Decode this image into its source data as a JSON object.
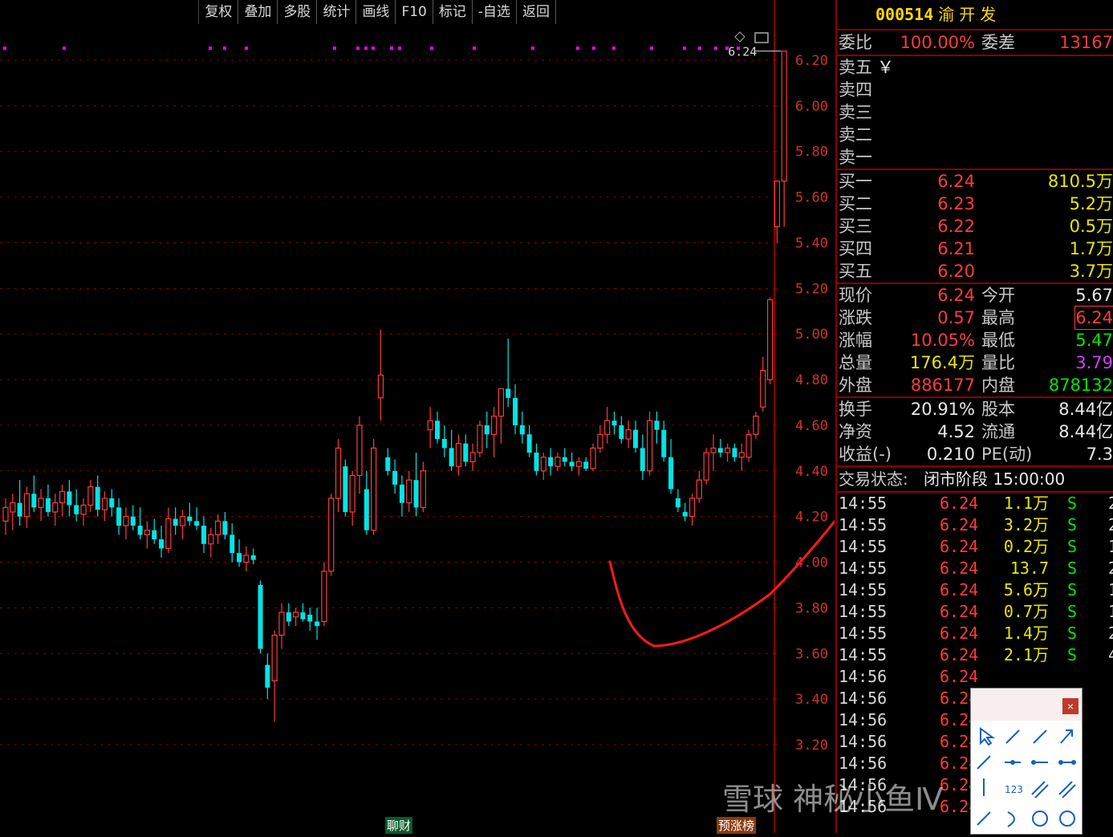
{
  "toolbar": {
    "items": [
      "复权",
      "叠加",
      "多股",
      "统计",
      "画线",
      "F10",
      "标记",
      "-自选",
      "返回"
    ]
  },
  "chart": {
    "y_ticks": [
      "6.20",
      "6.00",
      "5.80",
      "5.60",
      "5.40",
      "5.20",
      "5.00",
      "4.80",
      "4.60",
      "4.40",
      "4.20",
      "4.00",
      "3.80",
      "3.60",
      "3.40",
      "3.20"
    ],
    "high_label": "6.24",
    "badge_left": "聊财",
    "badge_right": "预涨榜",
    "colors": {
      "up": "#ff3b3b",
      "down": "#00e5e5",
      "grid": "#8b0000",
      "tick": "#d03030"
    }
  },
  "chart_data": {
    "type": "candlestick",
    "y_range": [
      3.1,
      6.3
    ],
    "candles": [
      {
        "o": 4.18,
        "h": 4.28,
        "l": 4.12,
        "c": 4.24
      },
      {
        "o": 4.22,
        "h": 4.3,
        "l": 4.14,
        "c": 4.26
      },
      {
        "o": 4.26,
        "h": 4.36,
        "l": 4.16,
        "c": 4.2
      },
      {
        "o": 4.2,
        "h": 4.33,
        "l": 4.15,
        "c": 4.3
      },
      {
        "o": 4.3,
        "h": 4.38,
        "l": 4.22,
        "c": 4.24
      },
      {
        "o": 4.24,
        "h": 4.32,
        "l": 4.18,
        "c": 4.28
      },
      {
        "o": 4.28,
        "h": 4.34,
        "l": 4.2,
        "c": 4.22
      },
      {
        "o": 4.22,
        "h": 4.3,
        "l": 4.16,
        "c": 4.26
      },
      {
        "o": 4.26,
        "h": 4.34,
        "l": 4.2,
        "c": 4.31
      },
      {
        "o": 4.31,
        "h": 4.36,
        "l": 4.2,
        "c": 4.25
      },
      {
        "o": 4.25,
        "h": 4.32,
        "l": 4.18,
        "c": 4.21
      },
      {
        "o": 4.21,
        "h": 4.28,
        "l": 4.16,
        "c": 4.25
      },
      {
        "o": 4.25,
        "h": 4.36,
        "l": 4.22,
        "c": 4.33
      },
      {
        "o": 4.33,
        "h": 4.38,
        "l": 4.2,
        "c": 4.23
      },
      {
        "o": 4.23,
        "h": 4.31,
        "l": 4.18,
        "c": 4.28
      },
      {
        "o": 4.28,
        "h": 4.32,
        "l": 4.2,
        "c": 4.24
      },
      {
        "o": 4.24,
        "h": 4.28,
        "l": 4.12,
        "c": 4.16
      },
      {
        "o": 4.16,
        "h": 4.24,
        "l": 4.1,
        "c": 4.2
      },
      {
        "o": 4.2,
        "h": 4.25,
        "l": 4.14,
        "c": 4.16
      },
      {
        "o": 4.16,
        "h": 4.24,
        "l": 4.1,
        "c": 4.12
      },
      {
        "o": 4.12,
        "h": 4.18,
        "l": 4.06,
        "c": 4.14
      },
      {
        "o": 4.14,
        "h": 4.19,
        "l": 4.08,
        "c": 4.1
      },
      {
        "o": 4.1,
        "h": 4.16,
        "l": 4.02,
        "c": 4.06
      },
      {
        "o": 4.06,
        "h": 4.24,
        "l": 4.04,
        "c": 4.19
      },
      {
        "o": 4.19,
        "h": 4.24,
        "l": 4.12,
        "c": 4.16
      },
      {
        "o": 4.16,
        "h": 4.23,
        "l": 4.1,
        "c": 4.2
      },
      {
        "o": 4.2,
        "h": 4.26,
        "l": 4.16,
        "c": 4.18
      },
      {
        "o": 4.18,
        "h": 4.24,
        "l": 4.14,
        "c": 4.16
      },
      {
        "o": 4.16,
        "h": 4.2,
        "l": 4.04,
        "c": 4.08
      },
      {
        "o": 4.08,
        "h": 4.15,
        "l": 4.02,
        "c": 4.12
      },
      {
        "o": 4.12,
        "h": 4.21,
        "l": 4.08,
        "c": 4.18
      },
      {
        "o": 4.18,
        "h": 4.22,
        "l": 4.1,
        "c": 4.12
      },
      {
        "o": 4.12,
        "h": 4.17,
        "l": 4.0,
        "c": 4.04
      },
      {
        "o": 4.04,
        "h": 4.1,
        "l": 3.98,
        "c": 4.0
      },
      {
        "o": 4.0,
        "h": 4.07,
        "l": 3.96,
        "c": 4.03
      },
      {
        "o": 4.03,
        "h": 4.06,
        "l": 3.99,
        "c": 4.01
      },
      {
        "o": 3.9,
        "h": 3.92,
        "l": 3.6,
        "c": 3.62
      },
      {
        "o": 3.55,
        "h": 3.6,
        "l": 3.4,
        "c": 3.45
      },
      {
        "o": 3.48,
        "h": 3.7,
        "l": 3.3,
        "c": 3.68
      },
      {
        "o": 3.68,
        "h": 3.82,
        "l": 3.62,
        "c": 3.78
      },
      {
        "o": 3.78,
        "h": 3.82,
        "l": 3.72,
        "c": 3.74
      },
      {
        "o": 3.76,
        "h": 3.8,
        "l": 3.72,
        "c": 3.78
      },
      {
        "o": 3.78,
        "h": 3.82,
        "l": 3.74,
        "c": 3.75
      },
      {
        "o": 3.77,
        "h": 3.8,
        "l": 3.7,
        "c": 3.74
      },
      {
        "o": 3.74,
        "h": 3.8,
        "l": 3.66,
        "c": 3.72
      },
      {
        "o": 3.74,
        "h": 4.0,
        "l": 3.72,
        "c": 3.96
      },
      {
        "o": 3.96,
        "h": 4.3,
        "l": 3.94,
        "c": 4.28
      },
      {
        "o": 4.28,
        "h": 4.54,
        "l": 4.22,
        "c": 4.5
      },
      {
        "o": 4.42,
        "h": 4.45,
        "l": 4.2,
        "c": 4.22
      },
      {
        "o": 4.22,
        "h": 4.4,
        "l": 4.16,
        "c": 4.38
      },
      {
        "o": 4.38,
        "h": 4.64,
        "l": 4.3,
        "c": 4.6
      },
      {
        "o": 4.32,
        "h": 4.4,
        "l": 4.12,
        "c": 4.14
      },
      {
        "o": 4.14,
        "h": 4.54,
        "l": 4.12,
        "c": 4.5
      },
      {
        "o": 4.72,
        "h": 5.02,
        "l": 4.62,
        "c": 4.82
      },
      {
        "o": 4.46,
        "h": 4.5,
        "l": 4.38,
        "c": 4.4
      },
      {
        "o": 4.4,
        "h": 4.45,
        "l": 4.3,
        "c": 4.34
      },
      {
        "o": 4.34,
        "h": 4.38,
        "l": 4.2,
        "c": 4.26
      },
      {
        "o": 4.26,
        "h": 4.4,
        "l": 4.22,
        "c": 4.36
      },
      {
        "o": 4.36,
        "h": 4.48,
        "l": 4.2,
        "c": 4.24
      },
      {
        "o": 4.24,
        "h": 4.44,
        "l": 4.22,
        "c": 4.4
      },
      {
        "o": 4.58,
        "h": 4.68,
        "l": 4.5,
        "c": 4.62
      },
      {
        "o": 4.62,
        "h": 4.66,
        "l": 4.52,
        "c": 4.54
      },
      {
        "o": 4.54,
        "h": 4.6,
        "l": 4.46,
        "c": 4.5
      },
      {
        "o": 4.5,
        "h": 4.58,
        "l": 4.4,
        "c": 4.42
      },
      {
        "o": 4.42,
        "h": 4.56,
        "l": 4.38,
        "c": 4.52
      },
      {
        "o": 4.52,
        "h": 4.56,
        "l": 4.42,
        "c": 4.44
      },
      {
        "o": 4.44,
        "h": 4.52,
        "l": 4.4,
        "c": 4.48
      },
      {
        "o": 4.48,
        "h": 4.62,
        "l": 4.46,
        "c": 4.6
      },
      {
        "o": 4.6,
        "h": 4.66,
        "l": 4.5,
        "c": 4.56
      },
      {
        "o": 4.56,
        "h": 4.68,
        "l": 4.46,
        "c": 4.64
      },
      {
        "o": 4.64,
        "h": 4.72,
        "l": 4.52,
        "c": 4.76
      },
      {
        "o": 4.76,
        "h": 4.98,
        "l": 4.68,
        "c": 4.72
      },
      {
        "o": 4.72,
        "h": 4.78,
        "l": 4.56,
        "c": 4.6
      },
      {
        "o": 4.6,
        "h": 4.66,
        "l": 4.52,
        "c": 4.56
      },
      {
        "o": 4.56,
        "h": 4.6,
        "l": 4.46,
        "c": 4.48
      },
      {
        "o": 4.48,
        "h": 4.52,
        "l": 4.38,
        "c": 4.4
      },
      {
        "o": 4.4,
        "h": 4.48,
        "l": 4.36,
        "c": 4.46
      },
      {
        "o": 4.46,
        "h": 4.5,
        "l": 4.38,
        "c": 4.42
      },
      {
        "o": 4.42,
        "h": 4.48,
        "l": 4.4,
        "c": 4.46
      },
      {
        "o": 4.46,
        "h": 4.5,
        "l": 4.42,
        "c": 4.44
      },
      {
        "o": 4.44,
        "h": 4.48,
        "l": 4.4,
        "c": 4.42
      },
      {
        "o": 4.42,
        "h": 4.46,
        "l": 4.38,
        "c": 4.44
      },
      {
        "o": 4.44,
        "h": 4.46,
        "l": 4.4,
        "c": 4.41
      },
      {
        "o": 4.41,
        "h": 4.52,
        "l": 4.4,
        "c": 4.5
      },
      {
        "o": 4.5,
        "h": 4.6,
        "l": 4.48,
        "c": 4.56
      },
      {
        "o": 4.56,
        "h": 4.68,
        "l": 4.52,
        "c": 4.62
      },
      {
        "o": 4.62,
        "h": 4.66,
        "l": 4.56,
        "c": 4.6
      },
      {
        "o": 4.6,
        "h": 4.64,
        "l": 4.52,
        "c": 4.54
      },
      {
        "o": 4.54,
        "h": 4.62,
        "l": 4.5,
        "c": 4.58
      },
      {
        "o": 4.58,
        "h": 4.62,
        "l": 4.48,
        "c": 4.5
      },
      {
        "o": 4.5,
        "h": 4.56,
        "l": 4.36,
        "c": 4.4
      },
      {
        "o": 4.4,
        "h": 4.66,
        "l": 4.38,
        "c": 4.62
      },
      {
        "o": 4.62,
        "h": 4.66,
        "l": 4.52,
        "c": 4.58
      },
      {
        "o": 4.58,
        "h": 4.62,
        "l": 4.44,
        "c": 4.46
      },
      {
        "o": 4.46,
        "h": 4.54,
        "l": 4.3,
        "c": 4.32
      },
      {
        "o": 4.28,
        "h": 4.32,
        "l": 4.22,
        "c": 4.24
      },
      {
        "o": 4.22,
        "h": 4.26,
        "l": 4.18,
        "c": 4.2
      },
      {
        "o": 4.2,
        "h": 4.3,
        "l": 4.16,
        "c": 4.28
      },
      {
        "o": 4.28,
        "h": 4.4,
        "l": 4.26,
        "c": 4.36
      },
      {
        "o": 4.36,
        "h": 4.5,
        "l": 4.34,
        "c": 4.48
      },
      {
        "o": 4.48,
        "h": 4.56,
        "l": 4.4,
        "c": 4.5
      },
      {
        "o": 4.5,
        "h": 4.54,
        "l": 4.46,
        "c": 4.48
      },
      {
        "o": 4.48,
        "h": 4.52,
        "l": 4.44,
        "c": 4.5
      },
      {
        "o": 4.5,
        "h": 4.52,
        "l": 4.44,
        "c": 4.46
      },
      {
        "o": 4.46,
        "h": 4.52,
        "l": 4.4,
        "c": 4.48
      },
      {
        "o": 4.46,
        "h": 4.58,
        "l": 4.44,
        "c": 4.56
      },
      {
        "o": 4.56,
        "h": 4.66,
        "l": 4.54,
        "c": 4.64
      },
      {
        "o": 4.68,
        "h": 4.9,
        "l": 4.66,
        "c": 4.84
      },
      {
        "o": 4.8,
        "h": 5.16,
        "l": 4.78,
        "c": 5.15
      },
      {
        "o": 5.47,
        "h": 5.67,
        "l": 5.4,
        "c": 5.67
      },
      {
        "o": 5.67,
        "h": 6.24,
        "l": 5.47,
        "c": 6.24
      }
    ]
  },
  "quote": {
    "code": "000514",
    "name": "渝开发",
    "weibi_label": "委比",
    "weibi": "100.00%",
    "weicha_label": "委差",
    "weicha": "13167",
    "sell": [
      {
        "label": "卖五",
        "unit": "￥"
      },
      {
        "label": "卖四"
      },
      {
        "label": "卖三"
      },
      {
        "label": "卖二"
      },
      {
        "label": "卖一"
      }
    ],
    "buy": [
      {
        "label": "买一",
        "price": "6.24",
        "vol": "810.5万"
      },
      {
        "label": "买二",
        "price": "6.23",
        "vol": "5.2万"
      },
      {
        "label": "买三",
        "price": "6.22",
        "vol": "0.5万"
      },
      {
        "label": "买四",
        "price": "6.21",
        "vol": "1.7万"
      },
      {
        "label": "买五",
        "price": "6.20",
        "vol": "3.7万"
      }
    ],
    "stats": [
      {
        "l1": "现价",
        "v1": "6.24",
        "c1": "red",
        "l2": "今开",
        "v2": "5.67",
        "c2": "wht"
      },
      {
        "l1": "涨跌",
        "v1": "0.57",
        "c1": "red",
        "l2": "最高",
        "v2": "6.24",
        "c2": "red"
      },
      {
        "l1": "涨幅",
        "v1": "10.05%",
        "c1": "red",
        "l2": "最低",
        "v2": "5.47",
        "c2": "grn"
      },
      {
        "l1": "总量",
        "v1": "176.4万",
        "c1": "yel",
        "l2": "量比",
        "v2": "3.79",
        "c2": "pur"
      },
      {
        "l1": "外盘",
        "v1": "886177",
        "c1": "red",
        "l2": "内盘",
        "v2": "878132",
        "c2": "grn"
      }
    ],
    "fund": [
      {
        "l1": "换手",
        "v1": "20.91%",
        "l2": "股本",
        "v2": "8.44亿"
      },
      {
        "l1": "净资",
        "v1": "4.52",
        "l2": "流通",
        "v2": "8.44亿"
      },
      {
        "l1": "收益(-)",
        "v1": "0.210",
        "l2": "PE(动)",
        "v2": "7.3"
      }
    ],
    "status_label": "交易状态:",
    "status": "闭市阶段 15:00:00"
  },
  "ticks": [
    {
      "t": "14:55",
      "p": "6.24",
      "v": "1.1万",
      "bs": "S",
      "n": "2"
    },
    {
      "t": "14:55",
      "p": "6.24",
      "v": "3.2万",
      "bs": "S",
      "n": "2"
    },
    {
      "t": "14:55",
      "p": "6.24",
      "v": "0.2万",
      "bs": "S",
      "n": "1"
    },
    {
      "t": "14:55",
      "p": "6.24",
      "v": "13.7万",
      "bs": "S",
      "n": "2"
    },
    {
      "t": "14:55",
      "p": "6.24",
      "v": "5.6万",
      "bs": "S",
      "n": "1"
    },
    {
      "t": "14:55",
      "p": "6.24",
      "v": "0.7万",
      "bs": "S",
      "n": "1"
    },
    {
      "t": "14:55",
      "p": "6.24",
      "v": "1.4万",
      "bs": "S",
      "n": "2"
    },
    {
      "t": "14:55",
      "p": "6.24",
      "v": "2.1万",
      "bs": "S",
      "n": "4"
    },
    {
      "t": "14:56",
      "p": "6.24",
      "v": "",
      "bs": "",
      "n": ""
    },
    {
      "t": "14:56",
      "p": "6.24",
      "v": "",
      "bs": "",
      "n": ""
    },
    {
      "t": "14:56",
      "p": "6.24",
      "v": "",
      "bs": "",
      "n": ""
    },
    {
      "t": "14:56",
      "p": "6.24",
      "v": "",
      "bs": "",
      "n": ""
    },
    {
      "t": "14:56",
      "p": "6.24",
      "v": "",
      "bs": "",
      "n": ""
    },
    {
      "t": "14:56",
      "p": "6.24",
      "v": "",
      "bs": "",
      "n": ""
    },
    {
      "t": "14:56",
      "p": "6.24",
      "v": "",
      "bs": "",
      "n": ""
    }
  ],
  "draw_tools": {
    "close_label": "×"
  },
  "watermark": "雪球 神秘小鱼Ⅳ"
}
